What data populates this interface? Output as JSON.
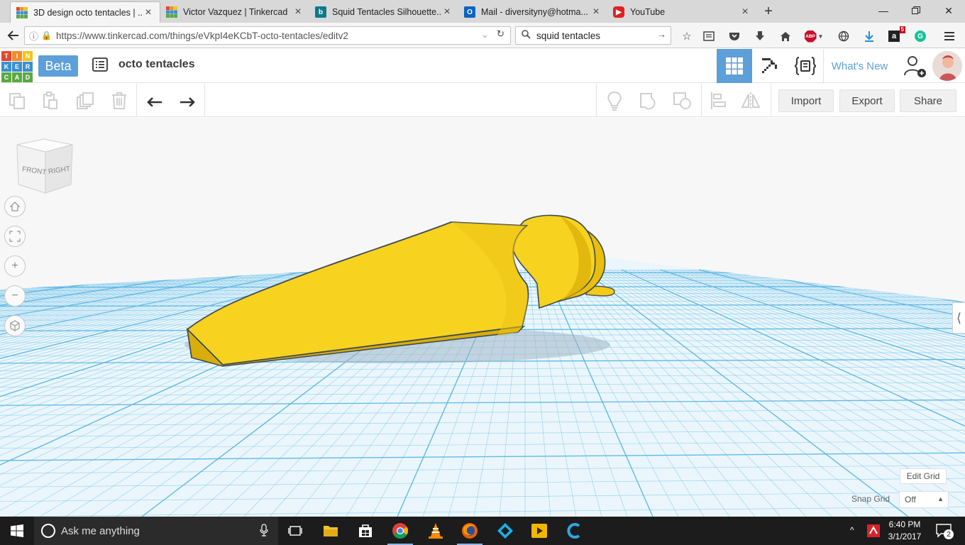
{
  "browser": {
    "tabs": [
      {
        "title": "3D design octo tentacles | ...",
        "favicon": "tinkercad-favicon",
        "active": true
      },
      {
        "title": "Victor Vazquez | Tinkercad",
        "favicon": "tinkercad-favicon",
        "active": false
      },
      {
        "title": "Squid Tentacles Silhouette...",
        "favicon": "bing-favicon",
        "active": false
      },
      {
        "title": "Mail - diversityny@hotma...",
        "favicon": "outlook-favicon",
        "active": false
      },
      {
        "title": "YouTube",
        "favicon": "youtube-favicon",
        "active": false
      }
    ],
    "url": "https://www.tinkercad.com/things/eVkpI4eKCbT-octo-tentacles/editv2",
    "search_value": "squid tentacles",
    "badge_abp": "ABP",
    "badge_count": "5"
  },
  "app": {
    "logo_letters": [
      "T",
      "I",
      "N",
      "K",
      "E",
      "R",
      "C",
      "A",
      "D"
    ],
    "logo_colors": [
      "#e2462f",
      "#f58a29",
      "#f6c41b",
      "#3a8fd0",
      "#3a8fd0",
      "#3a8fd0",
      "#5aa843",
      "#5aa843",
      "#5aa843"
    ],
    "beta_label": "Beta",
    "design_name": "octo tentacles",
    "whats_new": "What's New",
    "accent": "#5d9fd8"
  },
  "toolbar": {
    "import_label": "Import",
    "export_label": "Export",
    "share_label": "Share"
  },
  "workplane": {
    "viewcube_front": "FRONT",
    "viewcube_right": "RIGHT",
    "shape_color": "#f7d21f",
    "grid_color": "#5ab6e3",
    "edit_grid_label": "Edit Grid",
    "snap_grid_label": "Snap Grid",
    "snap_grid_value": "Off"
  },
  "taskbar": {
    "search_placeholder": "Ask me anything",
    "time": "6:40 PM",
    "date": "3/1/2017",
    "notification_count": "2"
  }
}
